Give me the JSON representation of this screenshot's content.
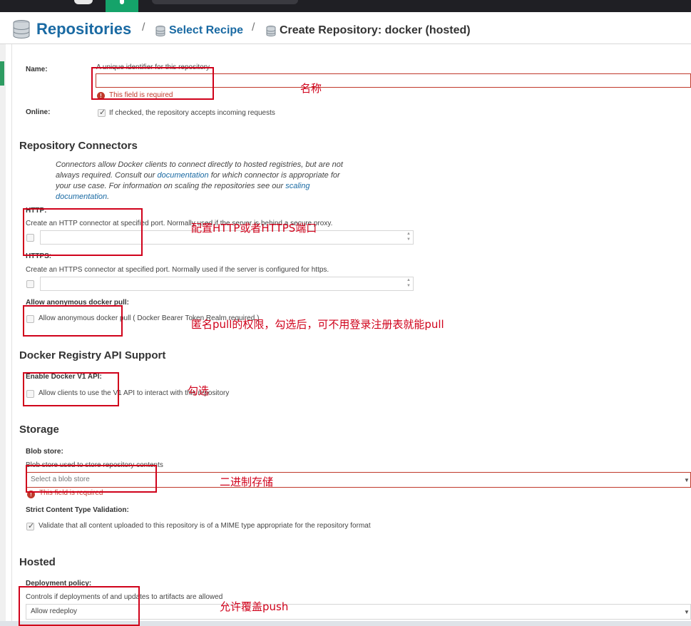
{
  "breadcrumb": {
    "root": "Repositories",
    "sep1": "/",
    "step": "Select Recipe",
    "sep2": "/",
    "current": "Create Repository: docker (hosted)"
  },
  "name_field": {
    "label": "Name:",
    "help": "A unique identifier for this repository",
    "value": "",
    "error": "This field is required"
  },
  "online_field": {
    "label": "Online:",
    "checked": true,
    "help": "If checked, the repository accepts incoming requests"
  },
  "connectors": {
    "title": "Repository Connectors",
    "description_1": "Connectors allow Docker clients to connect directly to hosted registries, but are not",
    "description_2a": "always required. Consult our ",
    "doc_link": "documentation",
    "description_2b": " for which connector is appropriate for",
    "description_3a": "your use case. For information on scaling the repositories see our ",
    "scaling_link": "scaling",
    "doc_link_2": "documentation",
    "description_4": ".",
    "http_label": "HTTP:",
    "http_help": "Create an HTTP connector at specified port. Normally used if the server is behind a secure proxy.",
    "https_label": "HTTPS:",
    "https_help": "Create an HTTPS connector at specified port. Normally used if the server is configured for https.",
    "anon_label": "Allow anonymous docker pull:",
    "anon_help": "Allow anonymous docker pull ( Docker Bearer Token Realm required )"
  },
  "docker_api": {
    "title": "Docker Registry API Support",
    "v1_label": "Enable Docker V1 API:",
    "v1_help": "Allow clients to use the V1 API to interact with this repository"
  },
  "storage": {
    "title": "Storage",
    "blob_label": "Blob store:",
    "blob_help": "Blob store used to store repository contents",
    "blob_placeholder": "Select a blob store",
    "blob_error": "This field is required",
    "strict_label": "Strict Content Type Validation:",
    "strict_checked": true,
    "strict_help": "Validate that all content uploaded to this repository is of a MIME type appropriate for the repository format"
  },
  "hosted": {
    "title": "Hosted",
    "policy_label": "Deployment policy:",
    "policy_help": "Controls if deployments of and updates to artifacts are allowed",
    "policy_value": "Allow redeploy"
  },
  "annotations": {
    "name": "名称",
    "ports": "配置HTTP或者HTTPS端口",
    "anon": "匿名pull的权限，勾选后，可不用登录注册表就能pull",
    "v1": "勾选",
    "blob": "二进制存储",
    "redeploy": "允许覆盖push"
  },
  "colors": {
    "brand_blue": "#1a6aa3",
    "active_green": "#15a36a",
    "error_red": "#c0392b",
    "annotation_red": "#d0021b"
  }
}
